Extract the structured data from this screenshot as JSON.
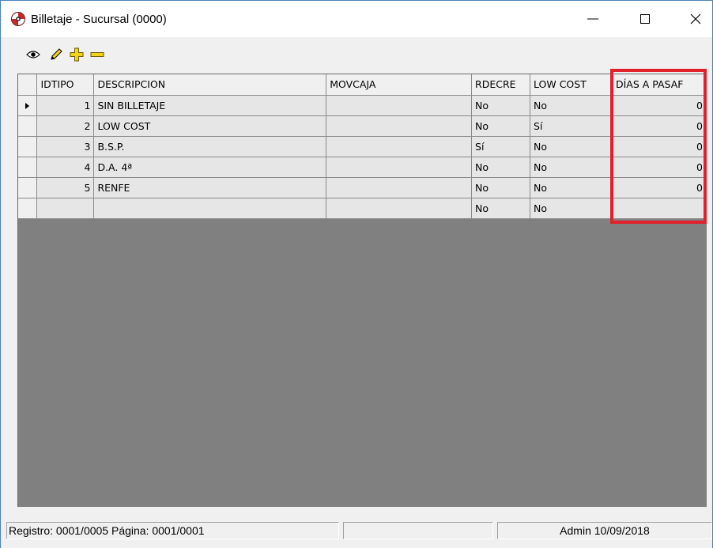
{
  "window": {
    "title": "Billetaje - Sucursal (0000)"
  },
  "toolbar": {
    "icons": [
      "eye-icon",
      "pencil-icon",
      "plus-icon",
      "minus-icon"
    ]
  },
  "grid": {
    "columns": [
      "IDTIPO",
      "DESCRIPCION",
      "MOVCAJA",
      "RDECRE",
      "LOW COST",
      "DÍAS A PASAF"
    ],
    "rows": [
      {
        "idtipo": "1",
        "descripcion": "SIN BILLETAJE",
        "movcaja": "",
        "rdecre": "No",
        "low_cost": "No",
        "dias": "0"
      },
      {
        "idtipo": "2",
        "descripcion": "LOW COST",
        "movcaja": "",
        "rdecre": "No",
        "low_cost": "Sí",
        "dias": "0"
      },
      {
        "idtipo": "3",
        "descripcion": "B.S.P.",
        "movcaja": "",
        "rdecre": "Sí",
        "low_cost": "No",
        "dias": "0"
      },
      {
        "idtipo": "4",
        "descripcion": "D.A. 4ª",
        "movcaja": "",
        "rdecre": "No",
        "low_cost": "No",
        "dias": "0"
      },
      {
        "idtipo": "5",
        "descripcion": "RENFE",
        "movcaja": "",
        "rdecre": "No",
        "low_cost": "No",
        "dias": "0"
      },
      {
        "idtipo": "",
        "descripcion": "",
        "movcaja": "",
        "rdecre": "No",
        "low_cost": "No",
        "dias": ""
      }
    ],
    "current_row": 0
  },
  "status": {
    "record": "Registro: 0001/0005  Página: 0001/0001",
    "middle": "",
    "user_date": "Admin 10/09/2018"
  },
  "colors": {
    "highlight": "#e0212b",
    "grid_background": "#808080"
  }
}
